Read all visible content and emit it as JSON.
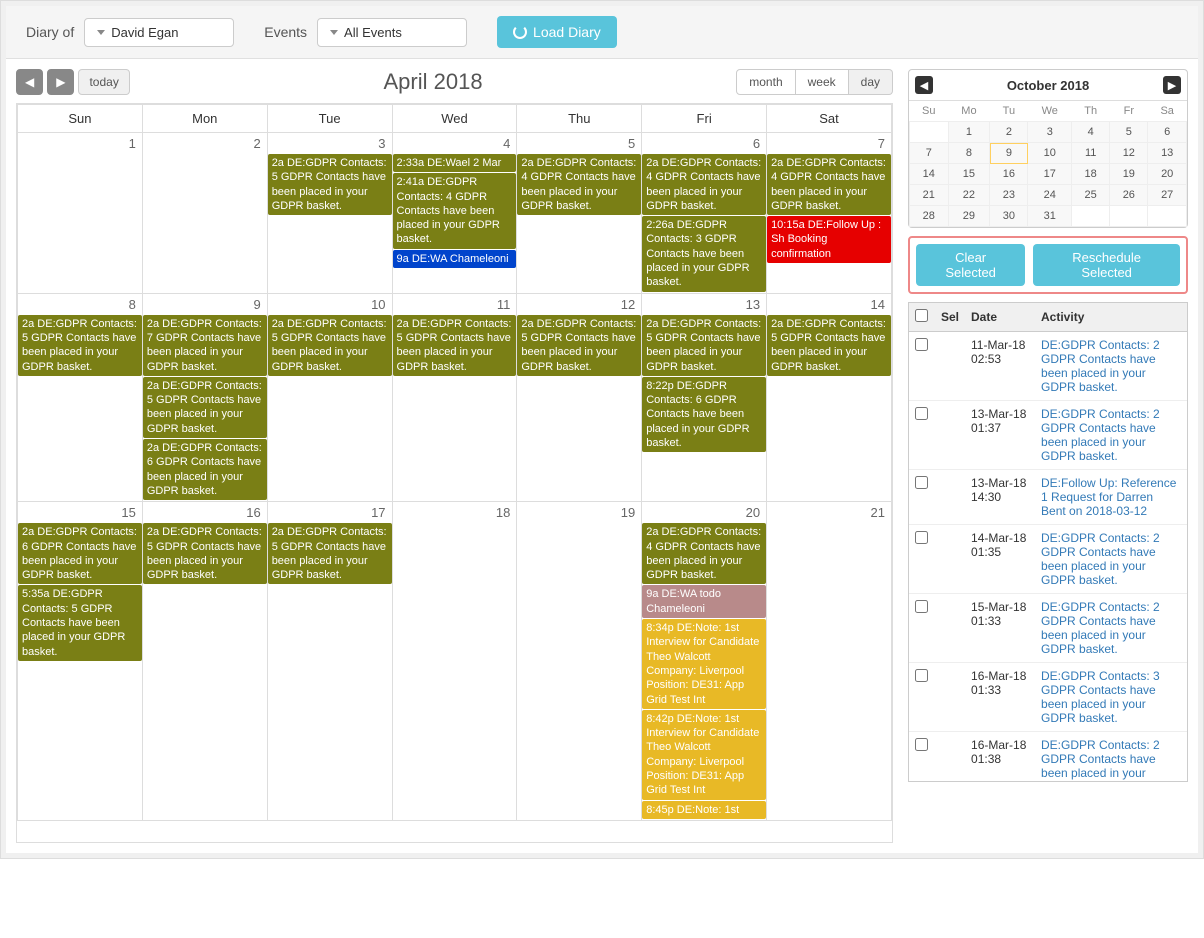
{
  "toolbar": {
    "diary_of": "Diary of",
    "user": "David Egan",
    "events_label": "Events",
    "events_filter": "All Events",
    "load": "Load Diary"
  },
  "calendar": {
    "title": "April 2018",
    "today": "today",
    "views": {
      "month": "month",
      "week": "week",
      "day": "day"
    },
    "active_view": "day",
    "days": [
      "Sun",
      "Mon",
      "Tue",
      "Wed",
      "Thu",
      "Fri",
      "Sat"
    ],
    "weeks": [
      [
        {
          "num": 1,
          "events": []
        },
        {
          "num": 2,
          "events": []
        },
        {
          "num": 3,
          "events": [
            {
              "cls": "ev-gdpr",
              "t": "2a DE:GDPR Contacts: 5 GDPR Contacts have been placed in your GDPR basket."
            }
          ]
        },
        {
          "num": 4,
          "events": [
            {
              "cls": "ev-gdpr",
              "t": "2:33a DE:Wael 2 Mar"
            },
            {
              "cls": "ev-gdpr",
              "t": "2:41a DE:GDPR Contacts: 4 GDPR Contacts have been placed in your GDPR basket."
            },
            {
              "cls": "ev-blue",
              "t": "9a DE:WA Chameleoni"
            }
          ]
        },
        {
          "num": 5,
          "events": [
            {
              "cls": "ev-gdpr",
              "t": "2a DE:GDPR Contacts: 4 GDPR Contacts have been placed in your GDPR basket."
            }
          ]
        },
        {
          "num": 6,
          "events": [
            {
              "cls": "ev-gdpr",
              "t": "2a DE:GDPR Contacts: 4 GDPR Contacts have been placed in your GDPR basket."
            },
            {
              "cls": "ev-gdpr",
              "t": "2:26a DE:GDPR Contacts: 3 GDPR Contacts have been placed in your GDPR basket."
            }
          ]
        },
        {
          "num": 7,
          "events": [
            {
              "cls": "ev-gdpr",
              "t": "2a DE:GDPR Contacts: 4 GDPR Contacts have been placed in your GDPR basket."
            },
            {
              "cls": "ev-red",
              "t": "10:15a DE:Follow Up : Sh Booking confirmation"
            }
          ]
        }
      ],
      [
        {
          "num": 8,
          "events": [
            {
              "cls": "ev-gdpr",
              "t": "2a DE:GDPR Contacts: 5 GDPR Contacts have been placed in your GDPR basket."
            }
          ]
        },
        {
          "num": 9,
          "events": [
            {
              "cls": "ev-gdpr",
              "t": "2a DE:GDPR Contacts: 7 GDPR Contacts have been placed in your GDPR basket."
            },
            {
              "cls": "ev-gdpr",
              "t": "2a DE:GDPR Contacts: 5 GDPR Contacts have been placed in your GDPR basket."
            },
            {
              "cls": "ev-gdpr",
              "t": "2a DE:GDPR Contacts: 6 GDPR Contacts have been placed in your GDPR basket."
            }
          ]
        },
        {
          "num": 10,
          "events": [
            {
              "cls": "ev-gdpr",
              "t": "2a DE:GDPR Contacts: 5 GDPR Contacts have been placed in your GDPR basket."
            }
          ]
        },
        {
          "num": 11,
          "events": [
            {
              "cls": "ev-gdpr",
              "t": "2a DE:GDPR Contacts: 5 GDPR Contacts have been placed in your GDPR basket."
            }
          ]
        },
        {
          "num": 12,
          "events": [
            {
              "cls": "ev-gdpr",
              "t": "2a DE:GDPR Contacts: 5 GDPR Contacts have been placed in your GDPR basket."
            }
          ]
        },
        {
          "num": 13,
          "events": [
            {
              "cls": "ev-gdpr",
              "t": "2a DE:GDPR Contacts: 5 GDPR Contacts have been placed in your GDPR basket."
            },
            {
              "cls": "ev-gdpr",
              "t": "8:22p DE:GDPR Contacts: 6 GDPR Contacts have been placed in your GDPR basket."
            }
          ]
        },
        {
          "num": 14,
          "events": [
            {
              "cls": "ev-gdpr",
              "t": "2a DE:GDPR Contacts: 5 GDPR Contacts have been placed in your GDPR basket."
            }
          ]
        }
      ],
      [
        {
          "num": 15,
          "events": [
            {
              "cls": "ev-gdpr",
              "t": "2a DE:GDPR Contacts: 6 GDPR Contacts have been placed in your GDPR basket."
            },
            {
              "cls": "ev-gdpr",
              "t": "5:35a DE:GDPR Contacts: 5 GDPR Contacts have been placed in your GDPR basket."
            }
          ]
        },
        {
          "num": 16,
          "events": [
            {
              "cls": "ev-gdpr",
              "t": "2a DE:GDPR Contacts: 5 GDPR Contacts have been placed in your GDPR basket."
            }
          ]
        },
        {
          "num": 17,
          "events": [
            {
              "cls": "ev-gdpr",
              "t": "2a DE:GDPR Contacts: 5 GDPR Contacts have been placed in your GDPR basket."
            }
          ]
        },
        {
          "num": 18,
          "events": []
        },
        {
          "num": 19,
          "events": []
        },
        {
          "num": 20,
          "events": [
            {
              "cls": "ev-gdpr",
              "t": "2a DE:GDPR Contacts: 4 GDPR Contacts have been placed in your GDPR basket."
            },
            {
              "cls": "ev-pink",
              "t": "9a DE:WA todo Chameleoni"
            },
            {
              "cls": "ev-gold",
              "t": "8:34p DE:Note: 1st Interview for Candidate Theo Walcott Company: Liverpool Position: DE31: App Grid Test Int"
            },
            {
              "cls": "ev-gold",
              "t": "8:42p DE:Note: 1st Interview for Candidate Theo Walcott Company: Liverpool Position: DE31: App Grid Test Int"
            },
            {
              "cls": "ev-gold",
              "t": "8:45p DE:Note: 1st"
            }
          ]
        },
        {
          "num": 21,
          "events": []
        }
      ]
    ]
  },
  "mini": {
    "title": "October 2018",
    "days": [
      "Su",
      "Mo",
      "Tu",
      "We",
      "Th",
      "Fr",
      "Sa"
    ],
    "rows": [
      [
        "",
        1,
        2,
        3,
        4,
        5,
        6
      ],
      [
        7,
        8,
        9,
        10,
        11,
        12,
        13
      ],
      [
        14,
        15,
        16,
        17,
        18,
        19,
        20
      ],
      [
        21,
        22,
        23,
        24,
        25,
        26,
        27
      ],
      [
        28,
        29,
        30,
        31,
        "",
        "",
        ""
      ]
    ],
    "today": 9
  },
  "actions": {
    "clear": "Clear Selected",
    "reschedule": "Reschedule Selected"
  },
  "activity": {
    "headers": {
      "sel": "Sel",
      "date": "Date",
      "activity": "Activity"
    },
    "rows": [
      {
        "date": "11-Mar-18 02:53",
        "text": "DE:GDPR Contacts: 2 GDPR Contacts have been placed in your GDPR basket."
      },
      {
        "date": "13-Mar-18 01:37",
        "text": "DE:GDPR Contacts: 2 GDPR Contacts have been placed in your GDPR basket."
      },
      {
        "date": "13-Mar-18 14:30",
        "text": "DE:Follow Up: Reference 1 Request for Darren Bent on 2018-03-12"
      },
      {
        "date": "14-Mar-18 01:35",
        "text": "DE:GDPR Contacts: 2 GDPR Contacts have been placed in your GDPR basket."
      },
      {
        "date": "15-Mar-18 01:33",
        "text": "DE:GDPR Contacts: 2 GDPR Contacts have been placed in your GDPR basket."
      },
      {
        "date": "16-Mar-18 01:33",
        "text": "DE:GDPR Contacts: 3 GDPR Contacts have been placed in your GDPR basket."
      },
      {
        "date": "16-Mar-18 01:38",
        "text": "DE:GDPR Contacts: 2 GDPR Contacts have been placed in your"
      }
    ]
  }
}
